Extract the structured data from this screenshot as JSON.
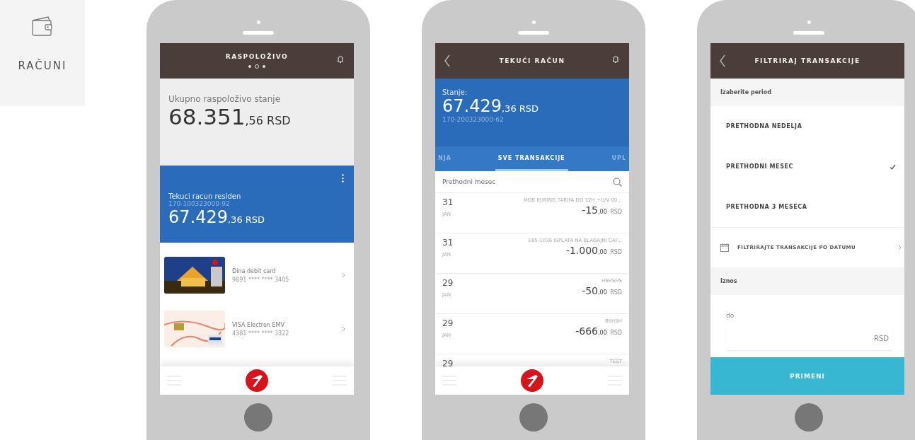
{
  "sidebar": {
    "label": "RAČUNI"
  },
  "phones": [
    {
      "kind": "overview",
      "header": {
        "title": "RASPOLOŽIVO",
        "pages": [
          {
            "selected": false
          },
          {
            "selected": true
          },
          {
            "selected": false
          }
        ]
      },
      "total": {
        "label": "Ukupno raspoloživo stanje",
        "amount": "68.351",
        "decimals": ",56",
        "currency": "RSD"
      },
      "account": {
        "name": "Tekuci racun residen",
        "number": "170-100323000-92",
        "amount": "67.429",
        "decimals": ",36",
        "currency": "RSD"
      },
      "cards": [
        {
          "name": "Dina debit card",
          "number": "9891 **** **** 3405"
        },
        {
          "name": "VISA Electron EMV",
          "number": "4381 **** **** 3322"
        }
      ]
    },
    {
      "kind": "transactions",
      "header": {
        "title": "TEKUĆI RAČUN"
      },
      "balance": {
        "label": "Stanje:",
        "amount": "67.429",
        "decimals": ",36",
        "currency": "RSD",
        "number": "170-200323000-62"
      },
      "tabs": [
        {
          "label": "NJA",
          "selected": false
        },
        {
          "label": "SVE TRANSAKCIJE",
          "selected": true
        },
        {
          "label": "UPL",
          "selected": false
        }
      ],
      "period": "Prethodni mesec",
      "transactions": [
        {
          "day": "31",
          "month": "JAN",
          "description": "MOB KURING TARIFA DO 12H +U/V 00...",
          "amount": "-15",
          "decimals": ",00",
          "currency": "RSD"
        },
        {
          "day": "31",
          "month": "JAN",
          "description": "E85-1036 ISPLATA NA BLAGAJNI CAF...",
          "amount": "-1.000",
          "decimals": ",00",
          "currency": "RSD"
        },
        {
          "day": "29",
          "month": "JAN",
          "description": "HSHSHS",
          "amount": "-50",
          "decimals": ",00",
          "currency": "RSD"
        },
        {
          "day": "29",
          "month": "JAN",
          "description": "BSHSH",
          "amount": "-666",
          "decimals": ",00",
          "currency": "RSD"
        },
        {
          "day": "29",
          "description": "TEST"
        }
      ]
    },
    {
      "kind": "filter",
      "header": {
        "title": "FILTRIRAJ TRANSAKCIJE"
      },
      "period_label": "Izaberite period",
      "periods": [
        {
          "label": "PRETHODNA NEDELJA",
          "selected": false
        },
        {
          "label": "PRETHODNI MESEC",
          "selected": true
        },
        {
          "label": "PRETHODNA 3 MESECA",
          "selected": false
        }
      ],
      "date_filter": "FILTRIRAJTE TRANSAKCIJE PO DATUMU",
      "amount_label": "Iznos",
      "amount_field": {
        "label": "do",
        "currency": "RSD"
      },
      "apply_button": "PRIMENI"
    }
  ]
}
